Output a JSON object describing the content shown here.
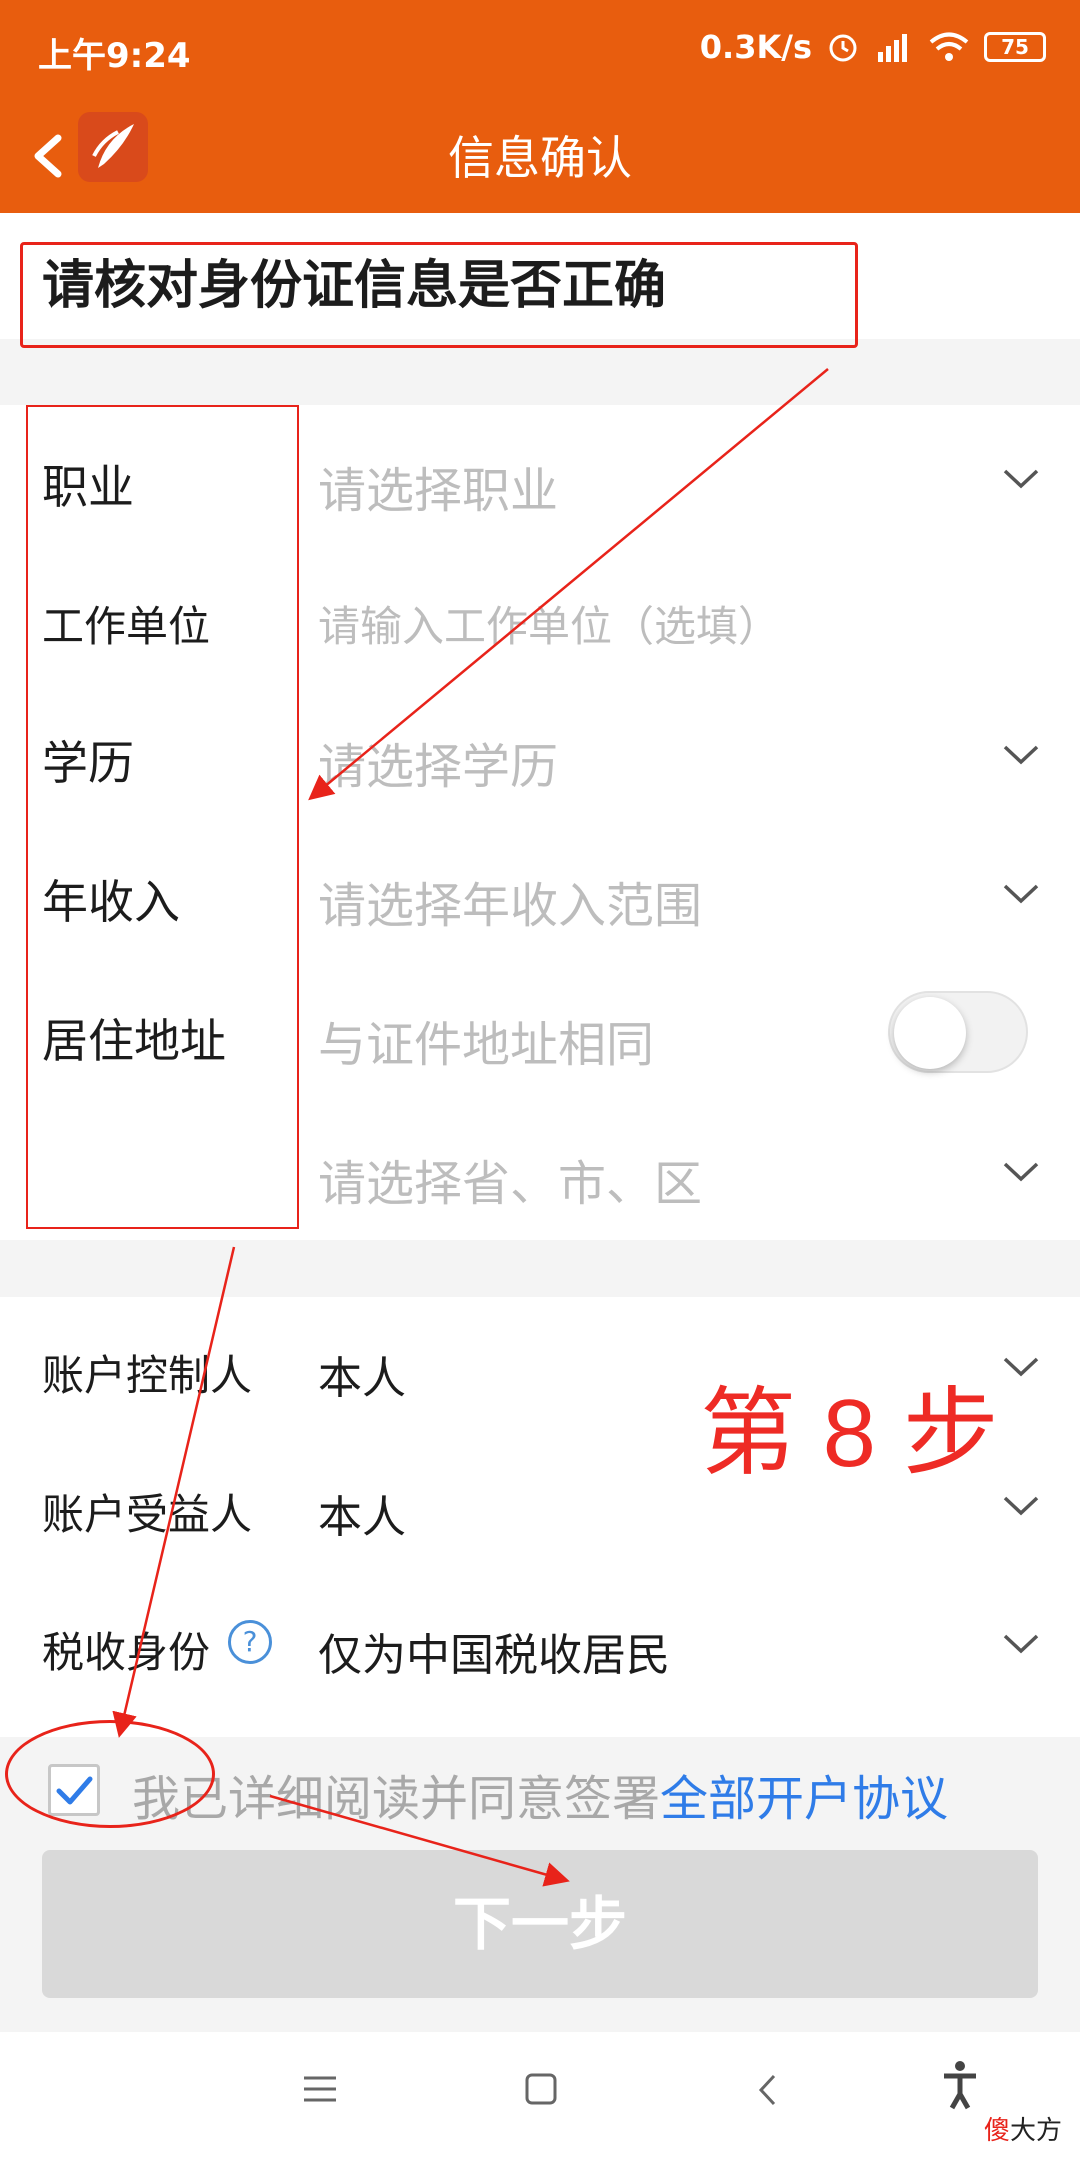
{
  "status": {
    "time": "上午9:24",
    "speed": "0.3K/s",
    "battery": "75"
  },
  "header": {
    "title": "信息确认"
  },
  "verify": {
    "title": "请核对身份证信息是否正确"
  },
  "form": {
    "occupation": {
      "label": "职业",
      "placeholder": "请选择职业"
    },
    "employer": {
      "label": "工作单位",
      "placeholder": "请输入工作单位（选填）"
    },
    "education": {
      "label": "学历",
      "placeholder": "请选择学历"
    },
    "income": {
      "label": "年收入",
      "placeholder": "请选择年收入范围"
    },
    "address": {
      "label": "居住地址",
      "same_as_id": "与证件地址相同",
      "region_placeholder": "请选择省、市、区",
      "same_as_id_on": false
    }
  },
  "account": {
    "controller": {
      "label": "账户控制人",
      "value": "本人"
    },
    "beneficiary": {
      "label": "账户受益人",
      "value": "本人"
    },
    "tax": {
      "label": "税收身份",
      "value": "仅为中国税收居民"
    }
  },
  "annotation": {
    "step": "第 8 步"
  },
  "agreement": {
    "text": "我已详细阅读并同意签署",
    "link": "全部开户协议",
    "checked": true
  },
  "next_button": "下一步",
  "watermark": {
    "char": "傻",
    "rest": "大方"
  },
  "colors": {
    "brand": "#e85d0e",
    "annotation_red": "#e8231a",
    "link": "#2f7ce8"
  }
}
